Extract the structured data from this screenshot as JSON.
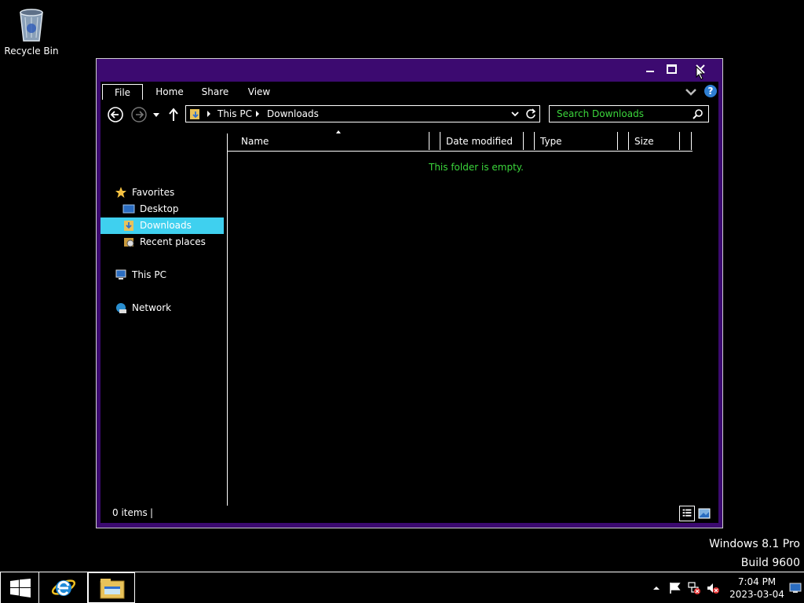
{
  "desktop": {
    "recycle_bin_label": "Recycle Bin"
  },
  "window": {
    "ribbon": {
      "tabs": [
        "File",
        "Home",
        "Share",
        "View"
      ],
      "help_label": "?"
    },
    "address": {
      "crumbs": [
        "This PC",
        "Downloads"
      ]
    },
    "search": {
      "placeholder": "Search Downloads"
    },
    "nav": {
      "favorites": "Favorites",
      "desktop": "Desktop",
      "downloads": "Downloads",
      "recent": "Recent places",
      "this_pc": "This PC",
      "network": "Network"
    },
    "columns": [
      "Name",
      "Date modified",
      "Type",
      "Size"
    ],
    "empty_message": "This folder is empty.",
    "status": {
      "items": "0 items",
      "sep": "|"
    }
  },
  "watermark": {
    "line1": "Windows 8.1 Pro",
    "line2": "Build 9600"
  },
  "clock": {
    "time": "7:04 PM",
    "date": "2023-03-04"
  },
  "colors": {
    "accent": "#3c0a70",
    "selection": "#3fd0ef",
    "green_text": "#3bd63b"
  }
}
